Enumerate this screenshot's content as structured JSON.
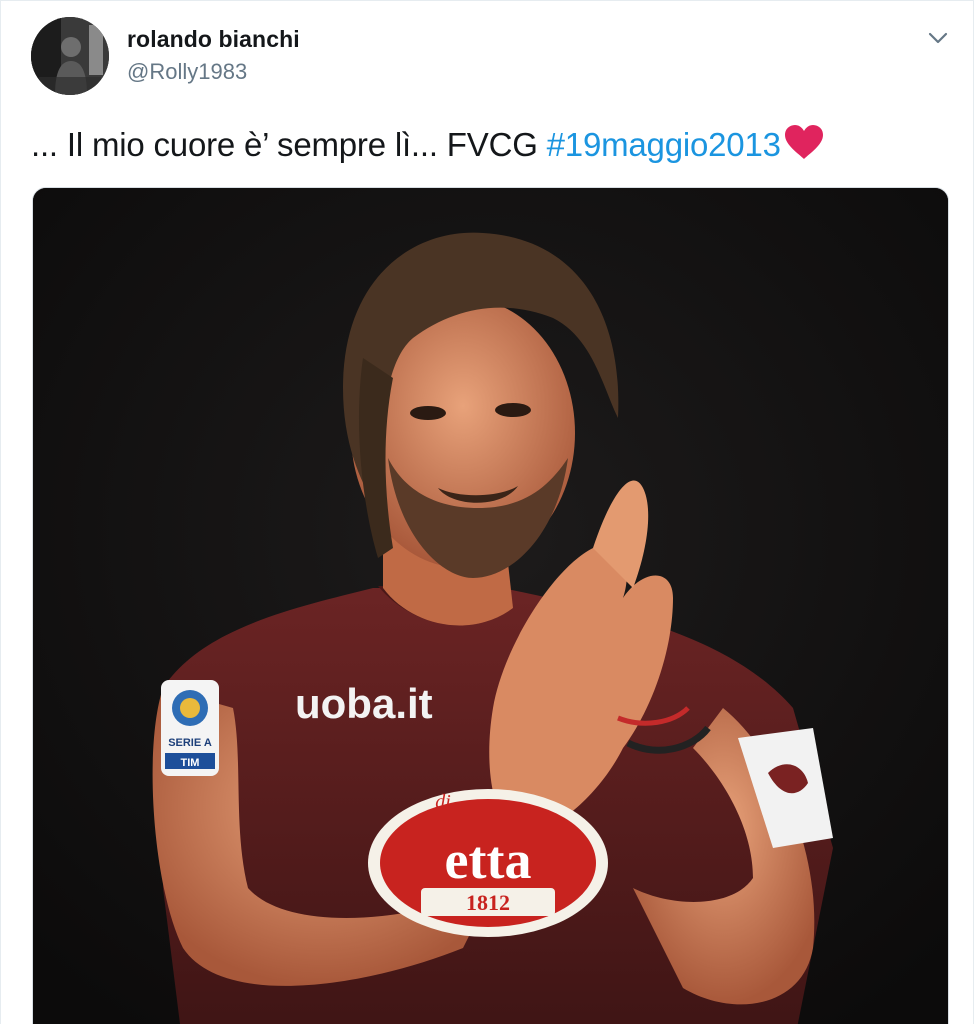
{
  "tweet": {
    "author": {
      "name": "rolando bianchi",
      "handle": "@Rolly1983",
      "avatar_icon": "profile-photo"
    },
    "menu_icon": "chevron-down-icon",
    "text_prefix": "... Il mio cuore è’ sempre lì... FVCG ",
    "hashtag": "#19maggio2013",
    "emoji": "red-heart",
    "media": {
      "description_icon": "photo",
      "shirt_lettering": {
        "sponsor": "uoba.it",
        "brand": "etta",
        "brand_prefix": "di",
        "year": "1812",
        "badge_line1": "SERIE A",
        "badge_line2": "TIM"
      }
    }
  },
  "colors": {
    "text": "#14171a",
    "secondary": "#657786",
    "link": "#1b95e0",
    "heart": "#e0245e",
    "jersey": "#5a1e1e"
  }
}
